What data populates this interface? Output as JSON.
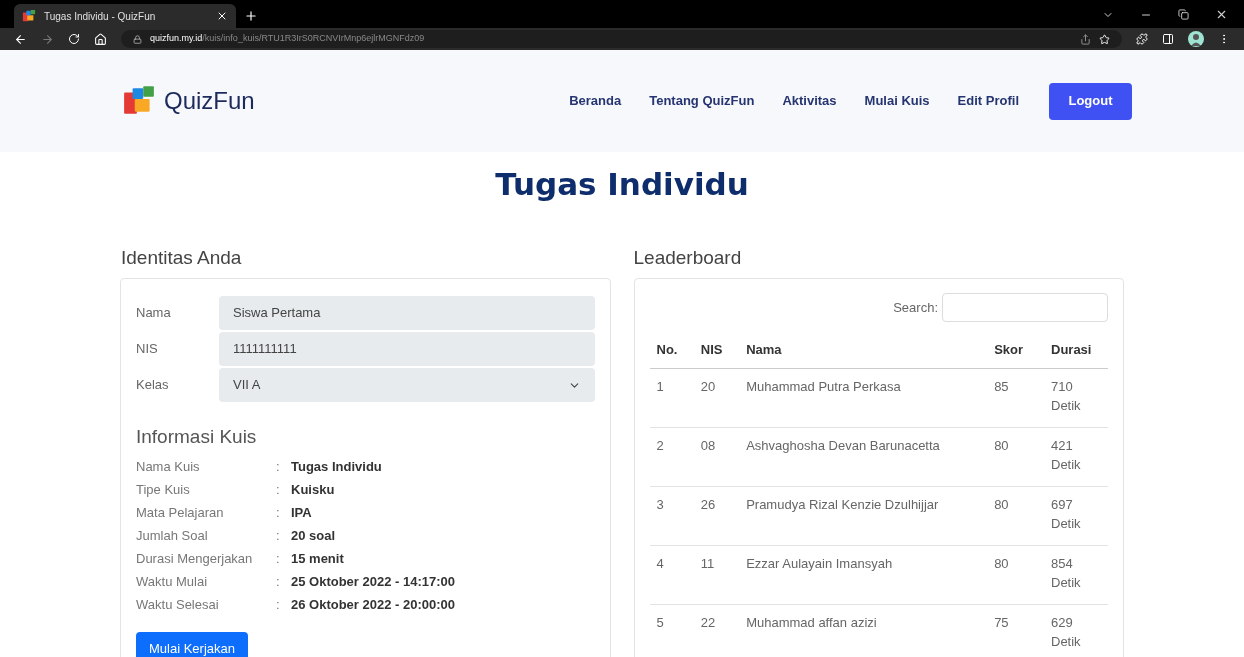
{
  "browser": {
    "tab_title": "Tugas Individu - QuizFun",
    "url_host": "quizfun.my.id",
    "url_path": "/kuis/info_kuis/RTU1R3IrS0RCNVIrMnp6ejlrMGNFdz09"
  },
  "navbar": {
    "brand": "QuizFun",
    "items": [
      "Beranda",
      "Tentang QuizFun",
      "Aktivitas",
      "Mulai Kuis",
      "Edit Profil"
    ],
    "logout": "Logout"
  },
  "page_title": "Tugas Individu",
  "identity": {
    "heading": "Identitas Anda",
    "fields": [
      {
        "label": "Nama",
        "value": "Siswa Pertama",
        "kind": "text"
      },
      {
        "label": "NIS",
        "value": "1111111111",
        "kind": "text"
      },
      {
        "label": "Kelas",
        "value": "VII A",
        "kind": "select"
      }
    ]
  },
  "quiz_info": {
    "heading": "Informasi Kuis",
    "rows": [
      {
        "label": "Nama Kuis",
        "separator": ":",
        "value": "Tugas Individu"
      },
      {
        "label": "Tipe Kuis",
        "separator": ":",
        "value": "Kuisku"
      },
      {
        "label": "Mata Pelajaran",
        "separator": ":",
        "value": "IPA"
      },
      {
        "label": "Jumlah Soal",
        "separator": ":",
        "value": "20 soal"
      },
      {
        "label": "Durasi Mengerjakan",
        "separator": ":",
        "value": "15 menit"
      },
      {
        "label": "Waktu Mulai",
        "separator": ":",
        "value": "25 Oktober 2022 - 14:17:00"
      },
      {
        "label": "Waktu Selesai",
        "separator": ":",
        "value": "26 Oktober 2022 - 20:00:00"
      }
    ]
  },
  "start_button": "Mulai Kerjakan",
  "leaderboard": {
    "heading": "Leaderboard",
    "search_label": "Search:",
    "columns": [
      "No.",
      "NIS",
      "Nama",
      "Skor",
      "Durasi"
    ],
    "rows": [
      [
        "1",
        "20",
        "Muhammad Putra Perkasa",
        "85",
        "710 Detik"
      ],
      [
        "2",
        "08",
        "Ashvaghosha Devan Barunacetta",
        "80",
        "421 Detik"
      ],
      [
        "3",
        "26",
        "Pramudya Rizal Kenzie Dzulhijjar",
        "80",
        "697 Detik"
      ],
      [
        "4",
        "11",
        "Ezzar Aulayain Imansyah",
        "80",
        "854 Detik"
      ],
      [
        "5",
        "22",
        "Muhammad affan azizi",
        "75",
        "629 Detik"
      ]
    ]
  }
}
